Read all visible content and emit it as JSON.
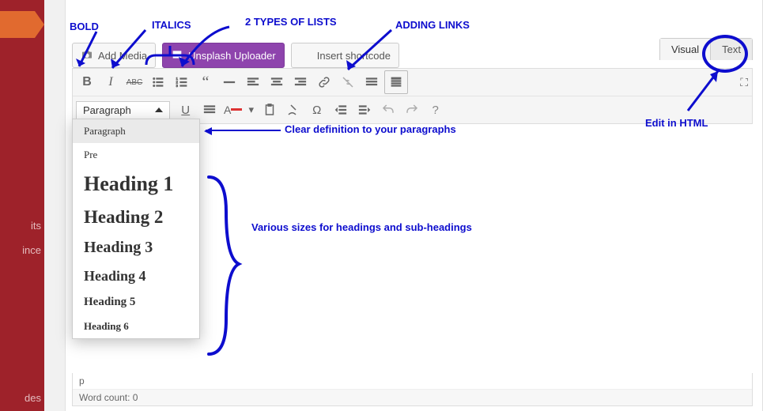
{
  "sidebar": {
    "items": [
      "its",
      "ince",
      "",
      "des"
    ]
  },
  "media_buttons": {
    "add_media": "Add Media",
    "unsplash": "Unsplash Uploader",
    "insert_shortcode": "Insert shortcode"
  },
  "tabs": {
    "visual": "Visual",
    "text": "Text"
  },
  "format_select": {
    "value": "Paragraph"
  },
  "dropdown": {
    "items": [
      {
        "label": "Paragraph",
        "class": "",
        "hover": true
      },
      {
        "label": "Pre",
        "class": ""
      },
      {
        "label": "Heading 1",
        "class": "h1"
      },
      {
        "label": "Heading 2",
        "class": "h2"
      },
      {
        "label": "Heading 3",
        "class": "h3"
      },
      {
        "label": "Heading 4",
        "class": "h4"
      },
      {
        "label": "Heading 5",
        "class": "h5"
      },
      {
        "label": "Heading 6",
        "class": "h6"
      }
    ]
  },
  "status": {
    "path": "p",
    "wordcount": "Word count: 0"
  },
  "annotations": {
    "bold": "BOLD",
    "italics": "ITALICS",
    "lists": "2 TYPES OF LISTS",
    "links": "ADDING LINKS",
    "clear": "Clear definition to your paragraphs",
    "headings": "Various sizes for headings and sub-headings",
    "html": "Edit in HTML"
  },
  "accent": "#0d0dce"
}
